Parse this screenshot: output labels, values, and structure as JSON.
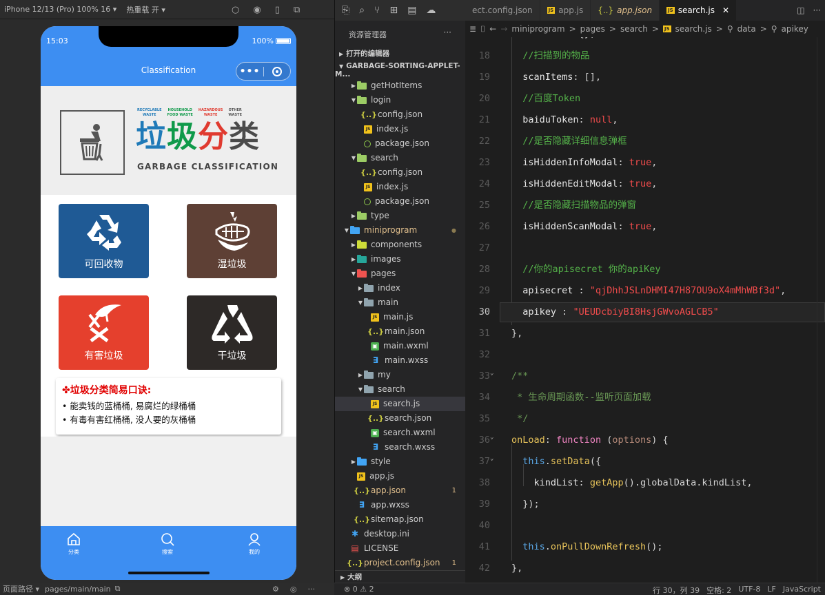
{
  "simulator": {
    "device": "iPhone 12/13 (Pro) 100% 16 ▾",
    "hot_reload": "热重载 开 ▾",
    "time": "15:03",
    "battery": "100%",
    "nav_title": "Classification",
    "capsule_dots": "•••",
    "banner": {
      "categories": [
        {
          "line1": "RECYCLABLE",
          "line2": "WASTE",
          "color": "#1f7ab8"
        },
        {
          "line1": "HOUSEHOLD",
          "line2": "FOOD WASTE",
          "color": "#0f9a4a"
        },
        {
          "line1": "HAZARDOUS",
          "line2": "WASTE",
          "color": "#e03a2f"
        },
        {
          "line1": "OTHER",
          "line2": "WASTE",
          "color": "#555555"
        }
      ],
      "title_chars": [
        "垃",
        "圾",
        "分",
        "类"
      ],
      "english": "GARBAGE CLASSIFICATION"
    },
    "tiles": [
      {
        "label": "可回收物",
        "color": "#1f5a95",
        "icon": "recycle-icon"
      },
      {
        "label": "湿垃圾",
        "color": "#5e4035",
        "icon": "fishbone-icon"
      },
      {
        "label": "有害垃圾",
        "color": "#e5402d",
        "icon": "hazard-icon"
      },
      {
        "label": "干垃圾",
        "color": "#2d2927",
        "icon": "dry-waste-icon"
      }
    ],
    "tips": {
      "heading": "✤垃圾分类简易口诀:",
      "rows": [
        "• 能卖钱的蓝桶桶, 易腐烂的绿桶桶",
        "• 有毒有害红桶桶, 没人要的灰桶桶"
      ]
    },
    "tabbar": [
      {
        "label": "分类",
        "icon": "home-icon"
      },
      {
        "label": "搜索",
        "icon": "search-icon"
      },
      {
        "label": "我的",
        "icon": "person-icon"
      }
    ],
    "footer": {
      "path_label": "页面路径 ▾",
      "path": "pages/main/main"
    }
  },
  "explorer": {
    "title": "资源管理器",
    "more": "···",
    "open_editors": "打开的编辑器",
    "project": "GARBAGE-SORTING-APPLET-M...",
    "tree": [
      {
        "depth": 1,
        "kind": "folder",
        "label": "getHotItems",
        "open": false,
        "color": "#9ccc65"
      },
      {
        "depth": 1,
        "kind": "folder",
        "label": "login",
        "open": true,
        "color": "#9ccc65"
      },
      {
        "depth": 2,
        "kind": "json",
        "label": "config.json"
      },
      {
        "depth": 2,
        "kind": "js",
        "label": "index.js"
      },
      {
        "depth": 2,
        "kind": "pkg",
        "label": "package.json"
      },
      {
        "depth": 1,
        "kind": "folder",
        "label": "search",
        "open": true,
        "color": "#9ccc65"
      },
      {
        "depth": 2,
        "kind": "json",
        "label": "config.json"
      },
      {
        "depth": 2,
        "kind": "js",
        "label": "index.js"
      },
      {
        "depth": 2,
        "kind": "pkg",
        "label": "package.json"
      },
      {
        "depth": 1,
        "kind": "folder",
        "label": "type",
        "open": false,
        "color": "#9ccc65"
      },
      {
        "depth": 0,
        "kind": "folder",
        "label": "miniprogram",
        "open": true,
        "color": "#42a5f5",
        "modified": true,
        "badge": "●"
      },
      {
        "depth": 1,
        "kind": "folder",
        "label": "components",
        "open": false,
        "color": "#cddc39"
      },
      {
        "depth": 1,
        "kind": "folder",
        "label": "images",
        "open": false,
        "color": "#26a69a"
      },
      {
        "depth": 1,
        "kind": "folder",
        "label": "pages",
        "open": true,
        "color": "#ef5350"
      },
      {
        "depth": 2,
        "kind": "folder",
        "label": "index",
        "open": false,
        "color": "#90a4ae"
      },
      {
        "depth": 2,
        "kind": "folder",
        "label": "main",
        "open": true,
        "color": "#90a4ae"
      },
      {
        "depth": 3,
        "kind": "js",
        "label": "main.js"
      },
      {
        "depth": 3,
        "kind": "json",
        "label": "main.json"
      },
      {
        "depth": 3,
        "kind": "wxml",
        "label": "main.wxml"
      },
      {
        "depth": 3,
        "kind": "wxss",
        "label": "main.wxss"
      },
      {
        "depth": 2,
        "kind": "folder",
        "label": "my",
        "open": false,
        "color": "#90a4ae"
      },
      {
        "depth": 2,
        "kind": "folder",
        "label": "search",
        "open": true,
        "color": "#90a4ae"
      },
      {
        "depth": 3,
        "kind": "js",
        "label": "search.js",
        "active": true
      },
      {
        "depth": 3,
        "kind": "json",
        "label": "search.json"
      },
      {
        "depth": 3,
        "kind": "wxml",
        "label": "search.wxml"
      },
      {
        "depth": 3,
        "kind": "wxss",
        "label": "search.wxss"
      },
      {
        "depth": 1,
        "kind": "folder",
        "label": "style",
        "open": false,
        "color": "#42a5f5"
      },
      {
        "depth": 1,
        "kind": "js",
        "label": "app.js"
      },
      {
        "depth": 1,
        "kind": "json",
        "label": "app.json",
        "modified": true,
        "badge": "1"
      },
      {
        "depth": 1,
        "kind": "wxss",
        "label": "app.wxss"
      },
      {
        "depth": 1,
        "kind": "json",
        "label": "sitemap.json"
      },
      {
        "depth": 0,
        "kind": "gear",
        "label": "desktop.ini"
      },
      {
        "depth": 0,
        "kind": "license",
        "label": "LICENSE"
      },
      {
        "depth": 0,
        "kind": "json",
        "label": "project.config.json",
        "modified": true,
        "badge": "1"
      }
    ],
    "outline": "大纲"
  },
  "editor": {
    "tabs": [
      {
        "label": "ect.config.json",
        "kind": "none"
      },
      {
        "label": "app.js",
        "kind": "js"
      },
      {
        "label": "app.json",
        "kind": "json",
        "italic": true,
        "modified": true
      },
      {
        "label": "search.js",
        "kind": "js",
        "active": true,
        "close": "✕"
      }
    ],
    "breadcrumb": [
      "miniprogram",
      "pages",
      "search",
      "search.js",
      "data",
      "apikey"
    ],
    "lines": [
      {
        "n": "18",
        "html": "  <span class=\"cmtg\">//扫描到的物品</span>"
      },
      {
        "n": "19",
        "html": "  <span class=\"prop\">scanItems</span>: [],"
      },
      {
        "n": "20",
        "html": "  <span class=\"cmtg\">//百度Token</span>"
      },
      {
        "n": "21",
        "html": "  <span class=\"prop\">baiduToken</span>: <span class=\"kwb\" style=\"color:#f14c4c\">null</span>,"
      },
      {
        "n": "22",
        "html": "  <span class=\"cmtg\">//是否隐藏详细信息弹框</span>"
      },
      {
        "n": "23",
        "html": "  <span class=\"prop\">isHiddenInfoModal</span>: <span class=\"str\">true</span>,"
      },
      {
        "n": "24",
        "html": "  <span class=\"prop\">isHiddenEditModal</span>: <span class=\"str\">true</span>,"
      },
      {
        "n": "25",
        "html": "  <span class=\"cmtg\">//是否隐藏扫描物品的弹窗</span>"
      },
      {
        "n": "26",
        "html": "  <span class=\"prop\">isHiddenScanModal</span>: <span class=\"str\">true</span>,"
      },
      {
        "n": "27",
        "html": ""
      },
      {
        "n": "28",
        "html": "  <span class=\"cmtg\">//你的apisecret 你的apiKey</span>"
      },
      {
        "n": "29",
        "html": "  <span class=\"prop\">apisecret</span> : <span class=\"str\">\"qjDhhJSLnDHMI47H87OU9oX4mMhWBf3d\"</span>,"
      },
      {
        "n": "30",
        "html": "  <span class=\"prop\">apikey</span> : <span class=\"str\">\"UEUDcbiyBI8HsjGWvoAGLCB5\"</span>",
        "current": true
      },
      {
        "n": "31",
        "html": "<span style=\"color:#d4d4d4\">},</span>"
      },
      {
        "n": "32",
        "html": ""
      },
      {
        "n": "33",
        "html": "<span class=\"cmt\">/**</span>",
        "fold": true
      },
      {
        "n": "34",
        "html": "<span class=\"cmt\"> * 生命周期函数--监听页面加载</span>"
      },
      {
        "n": "35",
        "html": "<span class=\"cmt\"> */</span>"
      },
      {
        "n": "36",
        "html": "<span class=\"fn\">onLoad</span>: <span class=\"kw\">function</span> (<span class=\"param\">options</span>) {",
        "fold": true
      },
      {
        "n": "37",
        "html": "  <span class=\"this\">this</span>.<span class=\"fn\">setData</span>({",
        "fold": true
      },
      {
        "n": "38",
        "html": "    <span class=\"prop\">kindList</span>: <span class=\"fn\">getApp</span>().globalData.kindList,"
      },
      {
        "n": "39",
        "html": "  });"
      },
      {
        "n": "40",
        "html": ""
      },
      {
        "n": "41",
        "html": "  <span class=\"this\">this</span>.<span class=\"fn\">onPullDownRefresh</span>();"
      },
      {
        "n": "42",
        "html": "},"
      }
    ],
    "partial_top": "selectItem: {},"
  },
  "statusbar": {
    "problems": "⊗ 0 ⚠ 2",
    "position": "行 30，列 39",
    "spaces": "空格: 2",
    "encoding": "UTF-8",
    "eol": "LF",
    "language": "JavaScript"
  }
}
